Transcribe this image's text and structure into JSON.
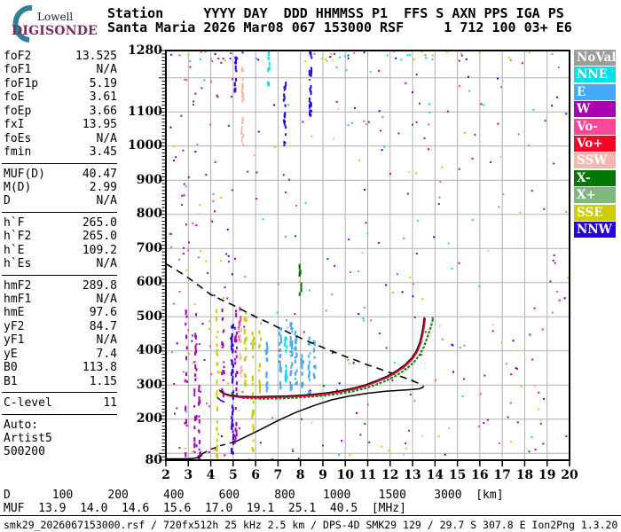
{
  "logo": {
    "top": "Lowell",
    "bottom": "DIGISONDE",
    "arc_color": "#2d7f9c"
  },
  "header": {
    "line1": "Station     YYYY DAY  DDD HHMMSS P1  FFS S AXN PPS IGA PS",
    "line2": "Santa Maria 2026 Mar08 067 153000 RSF     1 712 100 03+ E6"
  },
  "params": {
    "sections": [
      {
        "rows": [
          [
            "foF2",
            "13.525"
          ],
          [
            "foF1",
            "N/A"
          ],
          [
            "foF1p",
            "5.19"
          ],
          [
            "foE",
            "3.61"
          ],
          [
            "foEp",
            "3.66"
          ],
          [
            "fxI",
            "13.95"
          ],
          [
            "foEs",
            "N/A"
          ],
          [
            "fmin",
            "3.45"
          ]
        ]
      },
      {
        "rows": [
          [
            "MUF(D)",
            "40.47"
          ],
          [
            "M(D)",
            "2.99"
          ],
          [
            "D",
            "N/A"
          ]
        ]
      },
      {
        "rows": [
          [
            "h`F",
            "265.0"
          ],
          [
            "h`F2",
            "265.0"
          ],
          [
            "h`E",
            "109.2"
          ],
          [
            "h`Es",
            "N/A"
          ]
        ]
      },
      {
        "rows": [
          [
            "hmF2",
            "289.8"
          ],
          [
            "hmF1",
            "N/A"
          ],
          [
            "hmE",
            "97.6"
          ],
          [
            "yF2",
            "84.7"
          ],
          [
            "yF1",
            "N/A"
          ],
          [
            "yE",
            "7.4"
          ],
          [
            "B0",
            "113.8"
          ],
          [
            "B1",
            "1.15"
          ]
        ]
      },
      {
        "rows": [
          [
            "C-level",
            "11"
          ]
        ]
      }
    ],
    "footer": [
      "Auto:",
      "Artist5",
      "500200"
    ]
  },
  "legend": {
    "items": [
      {
        "label": "NoVal",
        "color": "#9c9c9c"
      },
      {
        "label": "NNE",
        "color": "#00e0e8"
      },
      {
        "label": "E",
        "color": "#45aaf8"
      },
      {
        "label": "W",
        "color": "#a800b0"
      },
      {
        "label": "Vo-",
        "color": "#fa4898"
      },
      {
        "label": "Vo+",
        "color": "#f80028"
      },
      {
        "label": "SSW",
        "color": "#f6b8ae"
      },
      {
        "label": "X-",
        "color": "#007800"
      },
      {
        "label": "X+",
        "color": "#7eb87e"
      },
      {
        "label": "SSE",
        "color": "#cccc00"
      },
      {
        "label": "NNW",
        "color": "#2800e0"
      }
    ]
  },
  "chart_data": {
    "type": "scatter",
    "title": "Digisonde ionogram with ARTIST5 autoscaled traces",
    "xlabel": "[MHz]",
    "ylabel": "[km]",
    "x_range": [
      2,
      20
    ],
    "y_range": [
      80,
      1280
    ],
    "x_ticks": [
      2,
      3,
      4,
      5,
      6,
      7,
      8,
      9,
      10,
      11,
      12,
      13,
      14,
      15,
      16,
      17,
      18,
      19,
      20
    ],
    "y_tick_labels": [
      1280,
      1100,
      1000,
      900,
      800,
      700,
      600,
      500,
      400,
      300,
      200,
      80
    ],
    "grid": "on",
    "grid_color": "#b0b0b0",
    "traces": {
      "transmission_dashed": [
        [
          2,
          655
        ],
        [
          2.5,
          636
        ],
        [
          3,
          614
        ],
        [
          3.5,
          590
        ],
        [
          4,
          565
        ],
        [
          4.5,
          549
        ],
        [
          5,
          534
        ],
        [
          5.5,
          517
        ],
        [
          6,
          500
        ],
        [
          6.5,
          485
        ],
        [
          7,
          469
        ],
        [
          7.5,
          453
        ],
        [
          8,
          438
        ],
        [
          8.5,
          424
        ],
        [
          9,
          410
        ],
        [
          9.5,
          397
        ],
        [
          10,
          384
        ],
        [
          10.5,
          372
        ],
        [
          11,
          359
        ],
        [
          11.5,
          348
        ],
        [
          12,
          336
        ],
        [
          12.5,
          325
        ],
        [
          12.9,
          315
        ],
        [
          13.2,
          307
        ],
        [
          13.45,
          301
        ]
      ],
      "profile_E_solid": [
        [
          2.0,
          84
        ],
        [
          2.8,
          84
        ],
        [
          3.2,
          85
        ],
        [
          3.45,
          88
        ],
        [
          3.58,
          93
        ],
        [
          3.62,
          99
        ]
      ],
      "valley_dashed": [
        [
          3.62,
          99
        ],
        [
          4.0,
          112
        ],
        [
          4.4,
          122
        ],
        [
          4.8,
          129
        ],
        [
          5.1,
          134
        ]
      ],
      "profile_F_solid": [
        [
          5.1,
          134
        ],
        [
          5.6,
          150
        ],
        [
          6.2,
          169
        ],
        [
          7,
          196
        ],
        [
          7.8,
          220
        ],
        [
          8.6,
          240
        ],
        [
          9.4,
          257
        ],
        [
          10.2,
          268
        ],
        [
          11,
          276
        ],
        [
          11.8,
          282
        ],
        [
          12.5,
          285
        ],
        [
          13,
          287
        ],
        [
          13.3,
          289
        ],
        [
          13.45,
          293
        ],
        [
          13.5,
          298
        ]
      ],
      "o_trace": [
        [
          4.4,
          284
        ],
        [
          4.6,
          274
        ],
        [
          4.9,
          268
        ],
        [
          5.3,
          265
        ],
        [
          6,
          264
        ],
        [
          6.7,
          265
        ],
        [
          7.4,
          266
        ],
        [
          8,
          268
        ],
        [
          8.6,
          271
        ],
        [
          9.2,
          275
        ],
        [
          9.8,
          281
        ],
        [
          10.4,
          289
        ],
        [
          10.9,
          298
        ],
        [
          11.4,
          310
        ],
        [
          11.9,
          324
        ],
        [
          12.3,
          339
        ],
        [
          12.7,
          358
        ],
        [
          13,
          378
        ],
        [
          13.2,
          398
        ],
        [
          13.35,
          422
        ],
        [
          13.45,
          450
        ],
        [
          13.52,
          478
        ],
        [
          13.55,
          497
        ]
      ],
      "x_trace": [
        [
          4.85,
          281
        ],
        [
          5.05,
          272
        ],
        [
          5.35,
          267
        ],
        [
          5.75,
          265
        ],
        [
          6.4,
          264
        ],
        [
          7.1,
          265
        ],
        [
          7.8,
          267
        ],
        [
          8.4,
          270
        ],
        [
          9,
          273
        ],
        [
          9.6,
          278
        ],
        [
          10.2,
          285
        ],
        [
          10.8,
          294
        ],
        [
          11.3,
          305
        ],
        [
          11.8,
          318
        ],
        [
          12.25,
          333
        ],
        [
          12.65,
          351
        ],
        [
          13,
          371
        ],
        [
          13.25,
          392
        ],
        [
          13.45,
          416
        ],
        [
          13.6,
          444
        ],
        [
          13.75,
          473
        ],
        [
          13.85,
          497
        ]
      ],
      "left_hook": [
        [
          4.3,
          263
        ],
        [
          4.45,
          255
        ],
        [
          4.62,
          250
        ]
      ]
    },
    "trace_colors": {
      "o_trace": "#e00040",
      "x_trace": "#0c8a0c",
      "fit": "#000000",
      "profile": "#000000"
    },
    "noise": {
      "seed": 1337,
      "bands": [
        {
          "f": 2,
          "df": 18,
          "h1": 1248,
          "h2": 1280,
          "n": 46,
          "colors": [
            "W",
            "NNW",
            "SSE",
            "NNE",
            "Vo-",
            "E"
          ]
        },
        {
          "f": 2,
          "df": 18,
          "h1": 80,
          "h2": 1280,
          "n": 200,
          "colors": [
            "W",
            "W",
            "W",
            "SSE",
            "NNW",
            "Vo-",
            "X-",
            "NNE",
            "E",
            "SSW"
          ]
        },
        {
          "f": 9.5,
          "df": 10.5,
          "h1": 80,
          "h2": 1280,
          "n": 80,
          "colors": [
            "W",
            "SSE",
            "X-",
            "NNW",
            "Vo-",
            "NNE",
            "E",
            "X+",
            "Vo+"
          ]
        },
        {
          "f": 2.2,
          "df": 2.8,
          "h1": 80,
          "h2": 1280,
          "n": 90,
          "colors": [
            "W",
            "W",
            "SSE",
            "Vo-",
            "NNW"
          ]
        }
      ],
      "columns": [
        {
          "f": 3.32,
          "h1": 85,
          "h2": 530,
          "c": "W",
          "n": 26
        },
        {
          "f": 3.5,
          "h1": 85,
          "h2": 300,
          "c": "W",
          "n": 18
        },
        {
          "f": 4.3,
          "h1": 90,
          "h2": 530,
          "c": "SSE",
          "n": 30
        },
        {
          "f": 4.55,
          "h1": 250,
          "h2": 520,
          "c": "W",
          "n": 16
        },
        {
          "f": 4.97,
          "h1": 95,
          "h2": 480,
          "c": "NNW",
          "n": 48
        },
        {
          "f": 5.12,
          "h1": 110,
          "h2": 520,
          "c": "W",
          "n": 26
        },
        {
          "f": 5.3,
          "h1": 420,
          "h2": 545,
          "c": "Vo-",
          "n": 12
        },
        {
          "f": 5.35,
          "h1": 300,
          "h2": 500,
          "c": "SSW",
          "n": 14
        },
        {
          "f": 5.42,
          "h1": 1000,
          "h2": 1270,
          "c": "SSW",
          "n": 22
        },
        {
          "f": 5.55,
          "h1": 290,
          "h2": 520,
          "c": "SSE",
          "n": 24
        },
        {
          "f": 5.9,
          "h1": 100,
          "h2": 515,
          "c": "SSE",
          "n": 28
        },
        {
          "f": 6.2,
          "h1": 255,
          "h2": 460,
          "c": "SSE",
          "n": 16
        },
        {
          "f": 6.5,
          "h1": 280,
          "h2": 430,
          "c": "E",
          "n": 18
        },
        {
          "f": 7.1,
          "h1": 290,
          "h2": 470,
          "c": "E",
          "n": 24
        },
        {
          "f": 7.35,
          "h1": 300,
          "h2": 450,
          "c": "NNE",
          "n": 18
        },
        {
          "f": 7.6,
          "h1": 280,
          "h2": 480,
          "c": "E",
          "n": 34
        },
        {
          "f": 7.8,
          "h1": 300,
          "h2": 460,
          "c": "E",
          "n": 20
        },
        {
          "f": 8.1,
          "h1": 290,
          "h2": 425,
          "c": "E",
          "n": 14
        },
        {
          "f": 8.4,
          "h1": 260,
          "h2": 440,
          "c": "E",
          "n": 18
        },
        {
          "f": 8.62,
          "h1": 300,
          "h2": 430,
          "c": "E",
          "n": 12
        },
        {
          "f": 7.3,
          "h1": 990,
          "h2": 1190,
          "c": "NNW",
          "n": 20
        },
        {
          "f": 8.45,
          "h1": 1090,
          "h2": 1280,
          "c": "NNW",
          "n": 26
        },
        {
          "f": 6.6,
          "h1": 1170,
          "h2": 1280,
          "c": "NNE",
          "n": 10
        },
        {
          "f": 5.1,
          "h1": 1150,
          "h2": 1280,
          "c": "NNW",
          "n": 12
        },
        {
          "f": 8.0,
          "h1": 560,
          "h2": 655,
          "c": "X-",
          "n": 12
        },
        {
          "f": 2.9,
          "h1": 85,
          "h2": 520,
          "c": "W",
          "n": 16
        }
      ]
    }
  },
  "dmuf": {
    "rows": [
      {
        "label": "D",
        "values": [
          "100",
          "200",
          "400",
          "600",
          "800",
          "1000",
          "1500",
          "3000"
        ],
        "unit": "[km]",
        "pad": 8
      },
      {
        "label": "MUF",
        "values": [
          "13.9",
          "14.0",
          "14.6",
          "15.6",
          "17.0",
          "19.1",
          "25.1",
          "40.5"
        ],
        "unit": "[MHz]",
        "pad": 6
      }
    ]
  },
  "status": "smk29_2026067153000.rsf / 720fx512h 25 kHz 2.5 km / DPS-4D SMK29 129 / 29.7 S 307.8 E Ion2Png 1.3.20"
}
